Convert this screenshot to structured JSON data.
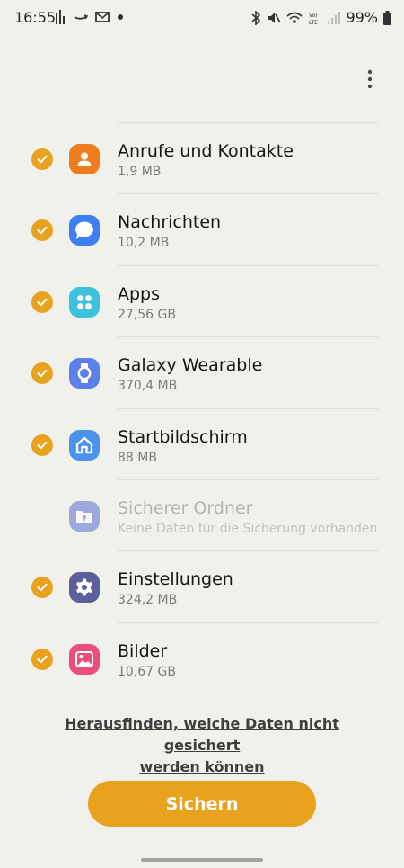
{
  "status_bar": {
    "time": "16:55",
    "battery": "99%",
    "left_icons": [
      "activity-icon",
      "amazon-icon",
      "mail-icon",
      "dot-icon"
    ],
    "right_icons": [
      "bluetooth-icon",
      "mute-icon",
      "wifi-calling-icon",
      "volte-icon",
      "signal-icon",
      "battery-icon"
    ]
  },
  "toolbar": {
    "more_icon": "more-vert-icon"
  },
  "items": [
    {
      "title": "Anrufe und Kontakte",
      "subtitle": "1,9 MB",
      "checked": true,
      "enabled": true,
      "icon": "person-icon",
      "color": "#ef7c1e"
    },
    {
      "title": "Nachrichten",
      "subtitle": "10,2 MB",
      "checked": true,
      "enabled": true,
      "icon": "message-icon",
      "color": "#3d7ef2"
    },
    {
      "title": "Apps",
      "subtitle": "27,56 GB",
      "checked": true,
      "enabled": true,
      "icon": "apps-grid-icon",
      "color": "#3cc2dc"
    },
    {
      "title": "Galaxy Wearable",
      "subtitle": "370,4 MB",
      "checked": true,
      "enabled": true,
      "icon": "watch-icon",
      "color": "#5c7fe8"
    },
    {
      "title": "Startbildschirm",
      "subtitle": "88 MB",
      "checked": true,
      "enabled": true,
      "icon": "home-icon",
      "color": "#4a92ec"
    },
    {
      "title": "Sicherer Ordner",
      "subtitle": "Keine Daten für die Sicherung vorhanden",
      "checked": false,
      "enabled": false,
      "icon": "secure-folder-icon",
      "color": "#4f62c9"
    },
    {
      "title": "Einstellungen",
      "subtitle": "324,2 MB",
      "checked": true,
      "enabled": true,
      "icon": "gear-icon",
      "color": "#5c5f9a"
    },
    {
      "title": "Bilder",
      "subtitle": "10,67 GB",
      "checked": true,
      "enabled": true,
      "icon": "image-icon",
      "color": "#ea4f7c"
    }
  ],
  "info_link": {
    "line1": "Herausfinden, welche Daten nicht gesichert",
    "line2": "werden können"
  },
  "primary_button": {
    "label": "Sichern"
  },
  "colors": {
    "accent": "#e8a21e",
    "background": "#f1f1ec"
  }
}
